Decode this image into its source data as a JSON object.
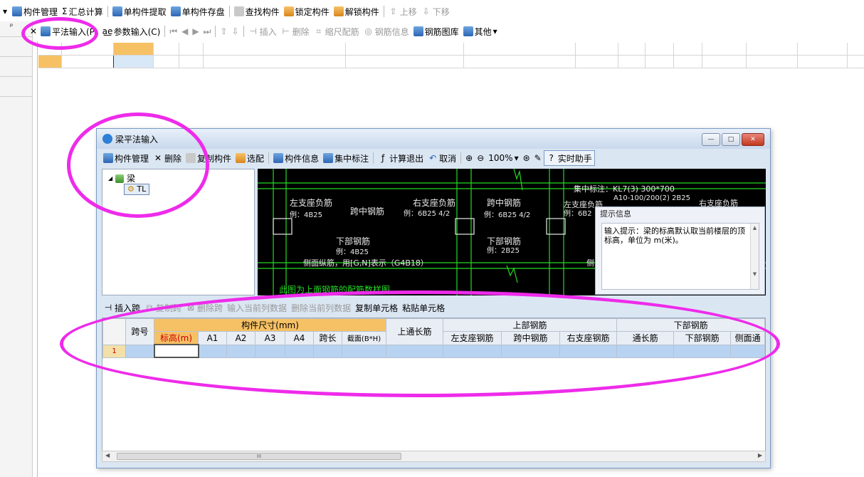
{
  "toolbar_main": {
    "items": [
      "构件管理",
      "汇总计算",
      "单构件提取",
      "单构件存盘",
      "查找构件",
      "锁定构件",
      "解锁构件",
      "上移",
      "下移"
    ],
    "sigma": "Σ"
  },
  "toolbar_input": {
    "pin": "ᵖ",
    "pingfa": "平法输入(P)",
    "canshu": "参数输入(C)",
    "insert": "插入",
    "delete": "删除",
    "scale": "缩尺配筋",
    "rebar_info": "钢筋信息",
    "rebar_lib": "钢筋图库",
    "other": "其他"
  },
  "dialog": {
    "title": "梁平法输入",
    "toolbar": {
      "manage": "构件管理",
      "delete": "删除",
      "copy": "复制构件",
      "select": "选配",
      "info": "构件信息",
      "centralized": "集中标注",
      "calc_exit": "计算退出",
      "cancel": "取消",
      "zoom": "100%",
      "helper": "实时助手"
    },
    "tree": {
      "root": "梁",
      "child": "TL"
    },
    "diagram": {
      "left_seat": "左支座负筋",
      "left_seat_ex": "例：4B25",
      "mid": "跨中钢筋",
      "right_seat": "右支座负筋",
      "right_seat_ex": "例：6B25 4/2",
      "mid2": "跨中钢筋",
      "mid2_ex": "例：6B25 4/2",
      "bottom": "下部钢筋",
      "bottom_ex": "例：4B25",
      "side": "侧面纵筋，用[G,N]表示（G4B18）",
      "bottom2": "下部钢筋",
      "bottom2_ex": "例：2B25",
      "concentrated": "集中标注：KL7(3) 300*700",
      "concentrated2": "A10-100/200(2) 2B25",
      "left_seat2": "左支座负筋",
      "left_seat2_ex": "例：6B2",
      "right_seat2": "右支座负筋",
      "caption": "此图为上面钢筋的配筋数样图.",
      "side_partial": "侧"
    },
    "hint": {
      "title": "提示信息",
      "body": "输入提示：梁的标高默认取当前楼层的顶标高，单位为 m(米)。"
    },
    "lower_toolbar": [
      "插入跨",
      "复制跨",
      "删除跨",
      "输入当前列数据",
      "删除当前列数据",
      "复制单元格",
      "粘贴单元格"
    ],
    "table": {
      "col_span": "跨号",
      "group_size": "构件尺寸(mm)",
      "col_elev": "标高(m)",
      "col_a1": "A1",
      "col_a2": "A2",
      "col_a3": "A3",
      "col_a4": "A4",
      "col_len": "跨长",
      "col_section": "截面(B*H)",
      "col_top_through": "上通长筋",
      "group_top": "上部钢筋",
      "col_left": "左支座钢筋",
      "col_mid": "跨中钢筋",
      "col_right": "右支座钢筋",
      "group_bottom": "下部钢筋",
      "col_through": "通长筋",
      "col_bottom": "下部钢筋",
      "col_side": "侧面通",
      "row1": "1"
    },
    "scroll_mark": "III"
  }
}
